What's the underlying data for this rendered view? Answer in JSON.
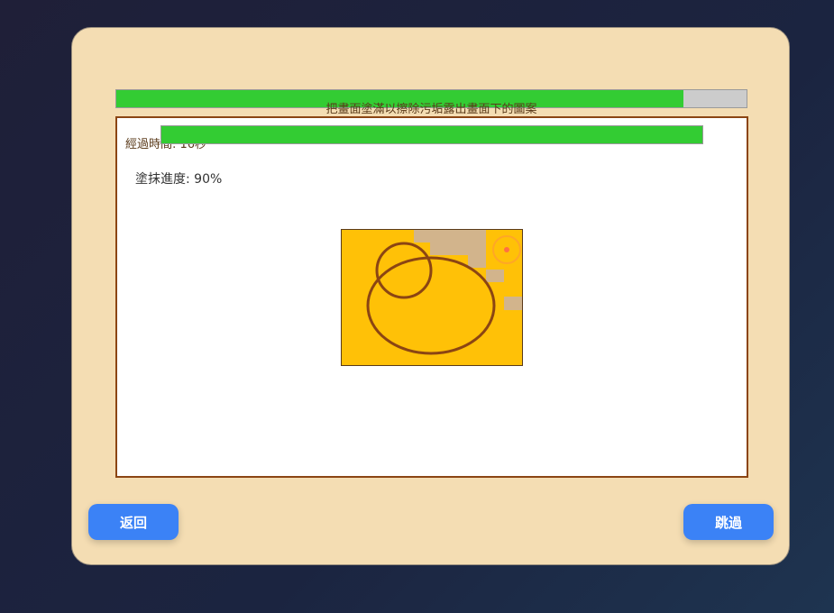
{
  "dialog": {
    "outer_progress_percent": 90,
    "instruction": "把畫面塗滿以擦除污垢露出畫面下的圖案",
    "elapsed_label": "經過時間: 16秒",
    "inner_progress_percent": 100,
    "paint_progress_label": "塗抹進度: 90%",
    "back_label": "返回",
    "skip_label": "跳過"
  },
  "colors": {
    "panel_bg": "#f4ddb3",
    "progress_fill": "#33cc33",
    "progress_track": "#cccccc",
    "canvas_border": "#8b4513",
    "paint_yellow": "#ffc107",
    "dirt": "#d2b48c",
    "outline": "#8b4513",
    "button_blue": "#3b82f6"
  },
  "icons": {
    "sun": "sun-icon"
  }
}
